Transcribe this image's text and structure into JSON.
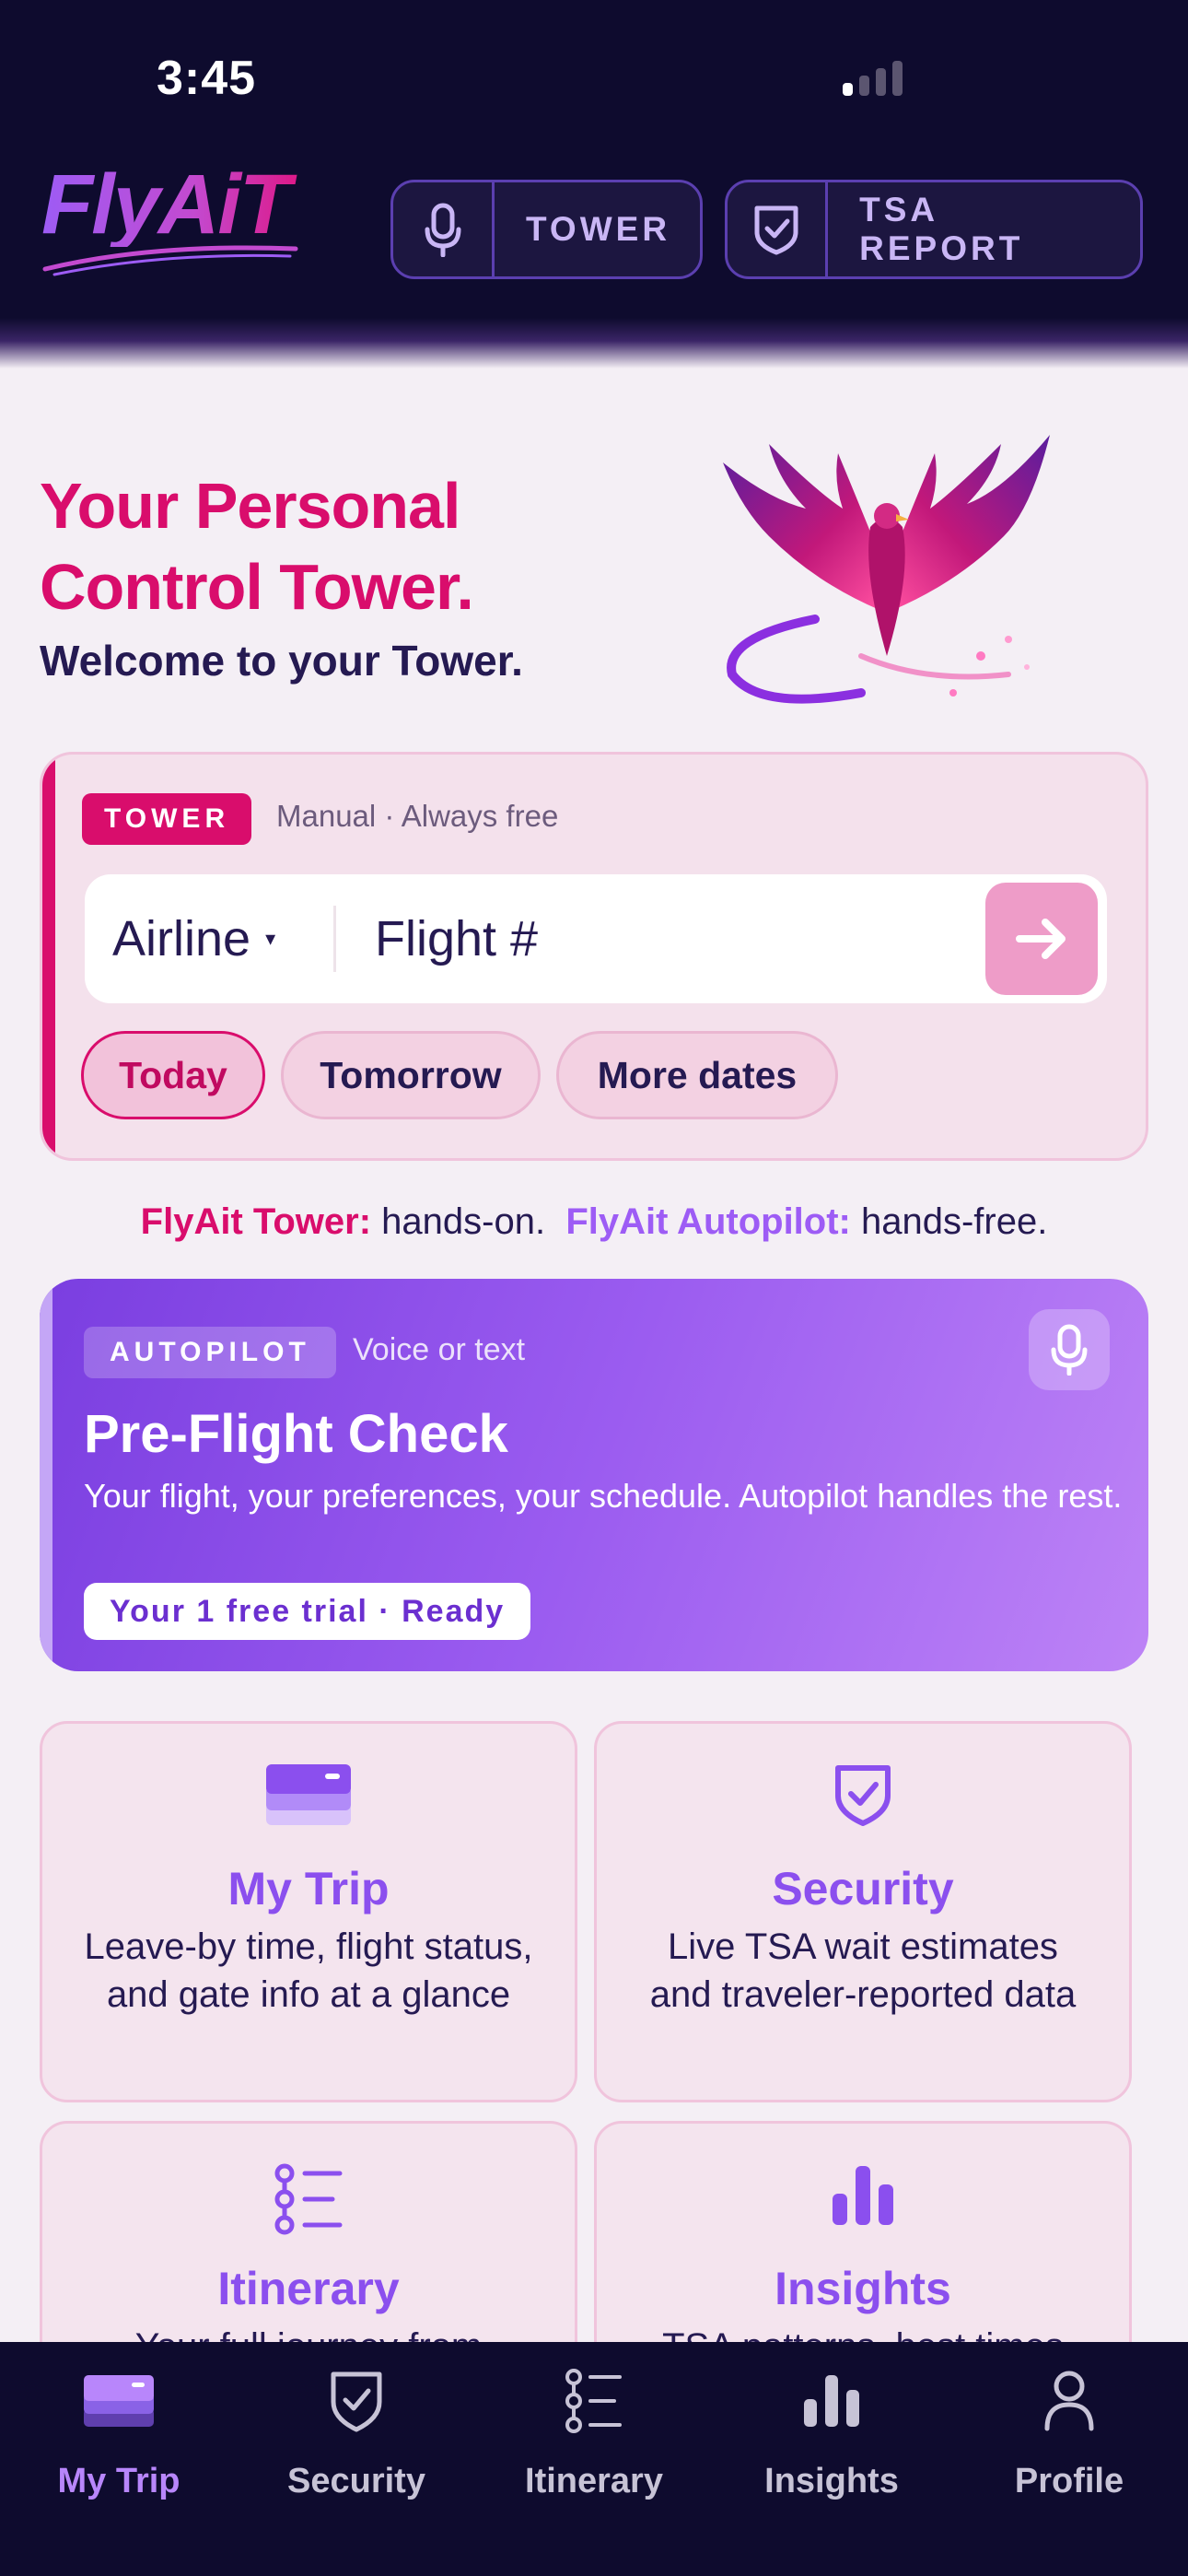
{
  "status_bar": {
    "time": "3:45"
  },
  "header": {
    "logo_text": "FlyAiT",
    "tower_button": "TOWER",
    "tsa_button": "TSA REPORT"
  },
  "hero": {
    "title": "Your Personal Control Tower.",
    "subtitle": "Welcome to your Tower."
  },
  "tower_card": {
    "badge": "TOWER",
    "note": "Manual · Always free",
    "airline_label": "Airline",
    "airline_caret": "▾",
    "flight_placeholder": "Flight #",
    "dates": [
      "Today",
      "Tomorrow",
      "More dates"
    ],
    "selected_date": "Today"
  },
  "tagline": {
    "tower_label": "FlyAit Tower:",
    "tower_text": "hands-on.",
    "autopilot_label": "FlyAit Autopilot:",
    "autopilot_text": "hands-free."
  },
  "autopilot_card": {
    "badge": "AUTOPILOT",
    "note": "Voice or text",
    "title": "Pre-Flight Check",
    "description": "Your flight, your preferences, your schedule. Autopilot handles the rest.",
    "trial": "Your 1 free trial · Ready"
  },
  "features": [
    {
      "icon": "card-stack-icon",
      "title": "My Trip",
      "description": "Leave-by time, flight status, and gate info at a glance"
    },
    {
      "icon": "shield-check-icon",
      "title": "Security",
      "description": "Live TSA wait estimates and traveler-reported data"
    },
    {
      "icon": "list-icon",
      "title": "Itinerary",
      "description": "Your full journey from"
    },
    {
      "icon": "bar-chart-icon",
      "title": "Insights",
      "description": "TSA patterns, best times"
    }
  ],
  "tabs": [
    {
      "label": "My Trip",
      "icon": "card-stack-icon",
      "active": true
    },
    {
      "label": "Security",
      "icon": "shield-check-icon",
      "active": false
    },
    {
      "label": "Itinerary",
      "icon": "list-icon",
      "active": false
    },
    {
      "label": "Insights",
      "icon": "bar-chart-icon",
      "active": false
    },
    {
      "label": "Profile",
      "icon": "person-icon",
      "active": false
    }
  ],
  "colors": {
    "brand_pink": "#d90d6c",
    "brand_purple": "#9d5cf5",
    "header_bg": "#0e0b2e"
  }
}
